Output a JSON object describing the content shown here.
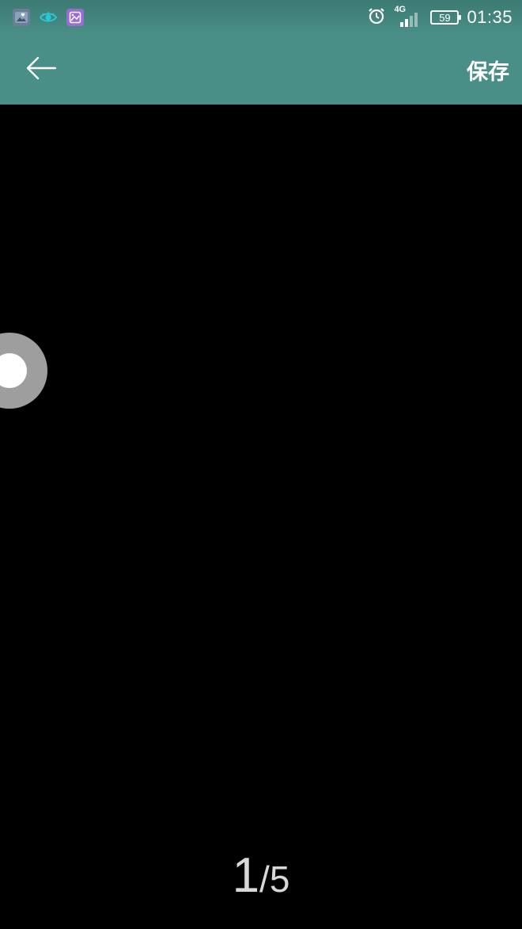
{
  "status_bar": {
    "notifications": [
      {
        "icon": "gallery-notification-icon"
      },
      {
        "icon": "eye-notification-icon"
      },
      {
        "icon": "photo-notification-icon"
      }
    ],
    "alarm_icon": "alarm-clock-icon",
    "network_type": "4G",
    "battery_level": "59",
    "time": "01:35"
  },
  "app_bar": {
    "back_icon": "arrow-left-icon",
    "save_label": "保存",
    "background_color": "#4a8f87"
  },
  "viewer": {
    "current_page": "1",
    "separator": "/",
    "total_pages": "5",
    "floating_button": "assistive-touch-ball",
    "background_color": "#000000"
  }
}
